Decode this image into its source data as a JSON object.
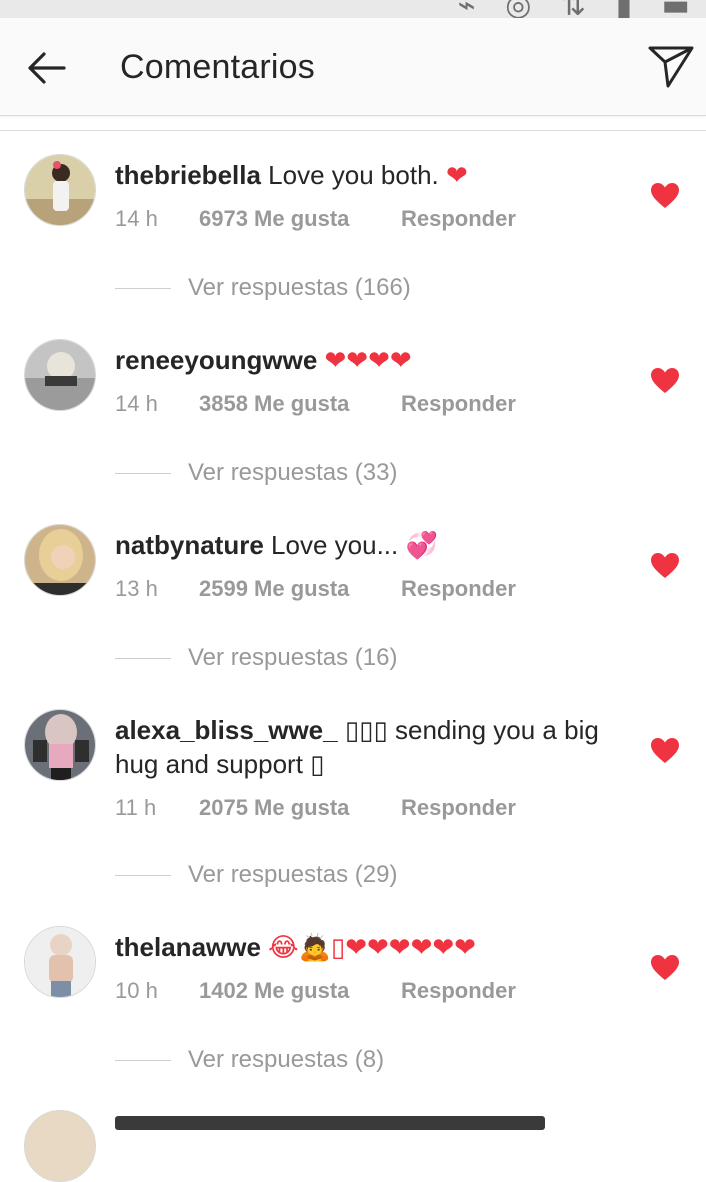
{
  "header": {
    "title": "Comentarios"
  },
  "comments": [
    {
      "username": "thebriebella",
      "text": "Love you both.",
      "emoji": "❤",
      "time": "14 h",
      "likes": "6973 Me gusta",
      "reply": "Responder",
      "replies": "Ver respuestas (166)"
    },
    {
      "username": "reneeyoungwwe",
      "text": "",
      "emoji": "❤❤❤❤",
      "time": "14 h",
      "likes": "3858 Me gusta",
      "reply": "Responder",
      "replies": "Ver respuestas (33)"
    },
    {
      "username": "natbynature",
      "text": "Love you...",
      "emoji": "💞",
      "time": "13 h",
      "likes": "2599 Me gusta",
      "reply": "Responder",
      "replies": "Ver respuestas (16)"
    },
    {
      "username": "alexa_bliss_wwe_",
      "text": "▯▯▯ sending you a big hug and support ▯",
      "emoji": "",
      "time": "11 h",
      "likes": "2075 Me gusta",
      "reply": "Responder",
      "replies": "Ver respuestas (29)"
    },
    {
      "username": "thelanawwe",
      "text": "",
      "emoji": "😂🙇▯❤❤❤❤❤❤",
      "time": "10 h",
      "likes": "1402 Me gusta",
      "reply": "Responder",
      "replies": "Ver respuestas (8)"
    }
  ],
  "colors": {
    "heart": "#ef3340",
    "meta": "#999999",
    "text": "#262626"
  }
}
